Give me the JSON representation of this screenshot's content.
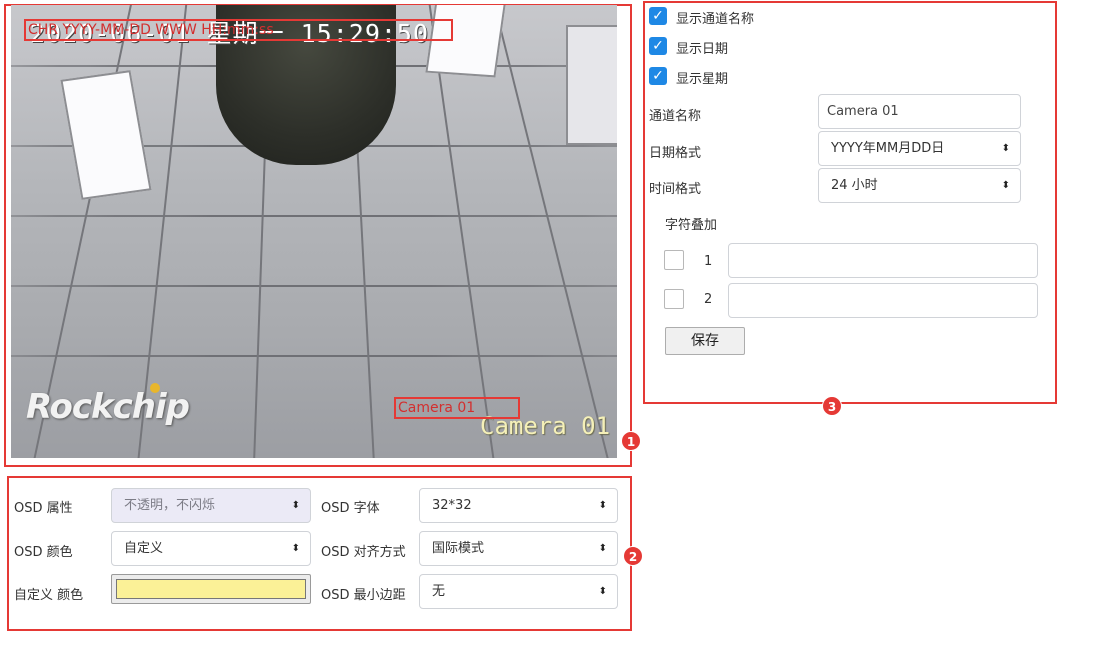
{
  "preview": {
    "osd_datetime": "2020-06-01 星期一 15:29:50",
    "osd_camera": "Camera 01",
    "logo": "Rockchip",
    "overlay_date_label": "CHR YYYY-MM-DD WWW HH:mm:ss",
    "overlay_camera_label": "Camera 01",
    "badge": "1"
  },
  "osd_props": {
    "badge": "2",
    "attr_label": "OSD 属性",
    "attr_value": "不透明，不闪烁",
    "font_label": "OSD 字体",
    "font_value": "32*32",
    "color_label": "OSD 颜色",
    "color_value": "自定义",
    "align_label": "OSD 对齐方式",
    "align_value": "国际模式",
    "custom_color_label": "自定义 颜色",
    "custom_color": "#fbf197",
    "margin_label": "OSD 最小边距",
    "margin_value": "无"
  },
  "settings": {
    "badge": "3",
    "show_channel_name": "显示通道名称",
    "show_date": "显示日期",
    "show_week": "显示星期",
    "channel_name_label": "通道名称",
    "channel_name_value": "Camera 01",
    "date_format_label": "日期格式",
    "date_format_value": "YYYY年MM月DD日",
    "time_format_label": "时间格式",
    "time_format_value": "24 小时",
    "char_overlay_label": "字符叠加",
    "overlay_rows": [
      {
        "index": "1",
        "text": ""
      },
      {
        "index": "2",
        "text": ""
      }
    ],
    "save_label": "保存"
  },
  "icons": {
    "check": "✓",
    "select_caret": "⬍"
  },
  "colors": {
    "highlight_red": "#e53935",
    "checkbox_blue": "#1e88e5"
  }
}
